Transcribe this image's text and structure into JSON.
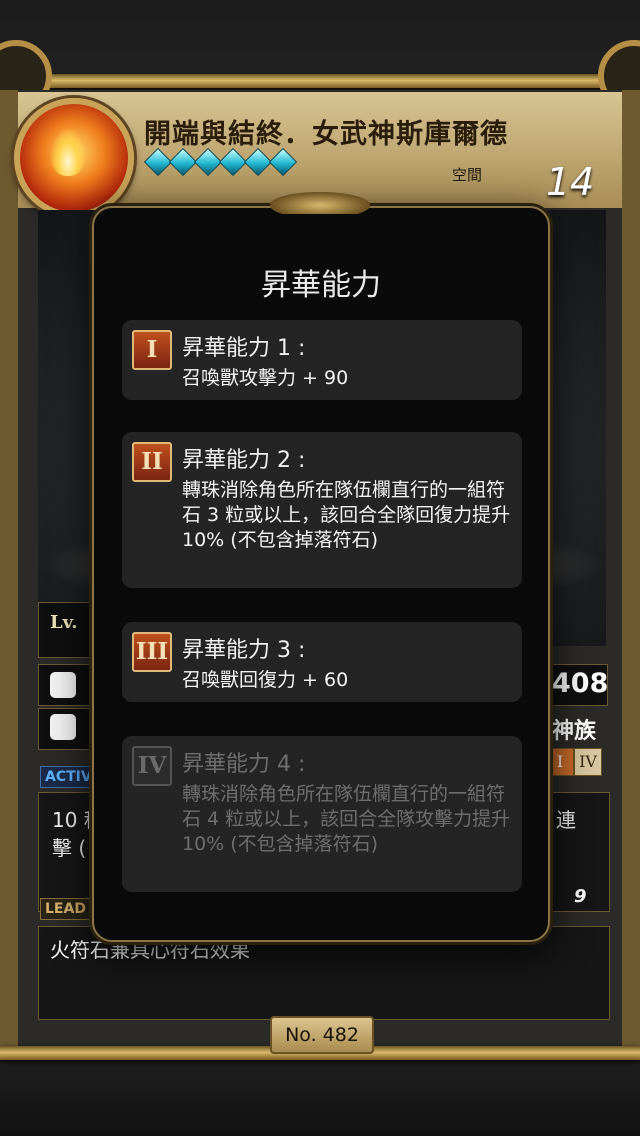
{
  "card": {
    "title": "開端與結終．女武神斯庫爾德",
    "space_label": "空間",
    "space_value": "14",
    "level_label": "Lv.",
    "hp_value": "408",
    "race": "神族",
    "active_tab": "ACTIV",
    "leader_tab": "LEAD",
    "skill_fragment_left": "10 秒",
    "skill_fragment_left2": "擊 (",
    "skill_fragment_right": "連",
    "skill_cd": "9",
    "leader_text": "火符石兼具心符石效果",
    "number_label": "No. 482",
    "rank_chips": [
      "I",
      "IV"
    ]
  },
  "modal": {
    "title": "昇華能力",
    "abilities": [
      {
        "numeral": "I",
        "name": "昇華能力 1 :",
        "desc": "召喚獸攻擊力 + 90",
        "locked": false
      },
      {
        "numeral": "II",
        "name": "昇華能力 2 :",
        "desc": "轉珠消除角色所在隊伍欄直行的一組符石 3 粒或以上，該回合全隊回復力提升 10% (不包含掉落符石)",
        "locked": false
      },
      {
        "numeral": "III",
        "name": "昇華能力 3 :",
        "desc": "召喚獸回復力 + 60",
        "locked": false
      },
      {
        "numeral": "IV",
        "name": "昇華能力 4 :",
        "desc": "轉珠消除角色所在隊伍欄直行的一組符石 4 粒或以上，該回合全隊攻擊力提升 10% (不包含掉落符石)",
        "locked": true
      }
    ]
  },
  "colors": {
    "gold": "#c9a458",
    "modal_bg": "#0a0a0a",
    "ability_bg": "#242424",
    "numeral_red": "#a0381a",
    "gem_cyan": "#21b8d0"
  },
  "icons": [
    "fire-element-icon",
    "star-gem-icon",
    "drop-icon",
    "heart-icon"
  ]
}
